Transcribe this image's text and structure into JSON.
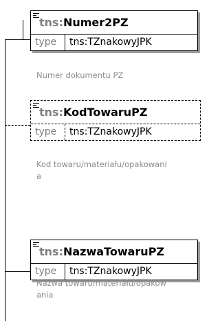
{
  "elements": [
    {
      "prefix": "tns:",
      "name": "Numer2PZ",
      "type_key": "type",
      "type_value": "tns:TZnakowyJPK",
      "doc": "Numer dokumentu PZ",
      "optional": false
    },
    {
      "prefix": "tns:",
      "name": "KodTowaruPZ",
      "type_key": "type",
      "type_value": "tns:TZnakowyJPK",
      "doc": "Kod towaru/materiału/opakowania",
      "optional": true
    },
    {
      "prefix": "tns:",
      "name": "NazwaTowaruPZ",
      "type_key": "type",
      "type_value": "tns:TZnakowyJPK",
      "doc": "Nazwa towaru/materiału/opakowania",
      "optional": false
    }
  ]
}
